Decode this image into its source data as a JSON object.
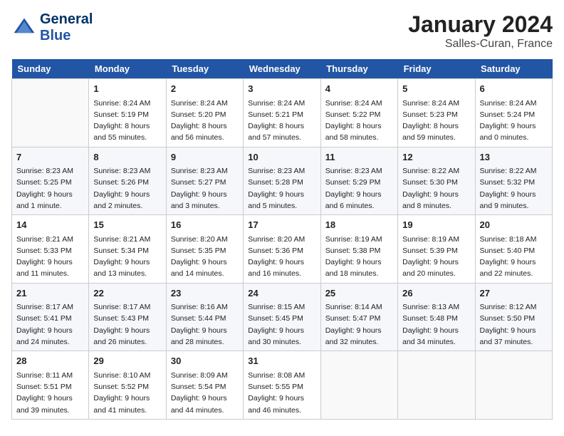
{
  "header": {
    "logo_general": "General",
    "logo_blue": "Blue",
    "month_title": "January 2024",
    "location": "Salles-Curan, France"
  },
  "days_of_week": [
    "Sunday",
    "Monday",
    "Tuesday",
    "Wednesday",
    "Thursday",
    "Friday",
    "Saturday"
  ],
  "weeks": [
    [
      {
        "day": "",
        "info": ""
      },
      {
        "day": "1",
        "info": "Sunrise: 8:24 AM\nSunset: 5:19 PM\nDaylight: 8 hours\nand 55 minutes."
      },
      {
        "day": "2",
        "info": "Sunrise: 8:24 AM\nSunset: 5:20 PM\nDaylight: 8 hours\nand 56 minutes."
      },
      {
        "day": "3",
        "info": "Sunrise: 8:24 AM\nSunset: 5:21 PM\nDaylight: 8 hours\nand 57 minutes."
      },
      {
        "day": "4",
        "info": "Sunrise: 8:24 AM\nSunset: 5:22 PM\nDaylight: 8 hours\nand 58 minutes."
      },
      {
        "day": "5",
        "info": "Sunrise: 8:24 AM\nSunset: 5:23 PM\nDaylight: 8 hours\nand 59 minutes."
      },
      {
        "day": "6",
        "info": "Sunrise: 8:24 AM\nSunset: 5:24 PM\nDaylight: 9 hours\nand 0 minutes."
      }
    ],
    [
      {
        "day": "7",
        "info": "Sunrise: 8:23 AM\nSunset: 5:25 PM\nDaylight: 9 hours\nand 1 minute."
      },
      {
        "day": "8",
        "info": "Sunrise: 8:23 AM\nSunset: 5:26 PM\nDaylight: 9 hours\nand 2 minutes."
      },
      {
        "day": "9",
        "info": "Sunrise: 8:23 AM\nSunset: 5:27 PM\nDaylight: 9 hours\nand 3 minutes."
      },
      {
        "day": "10",
        "info": "Sunrise: 8:23 AM\nSunset: 5:28 PM\nDaylight: 9 hours\nand 5 minutes."
      },
      {
        "day": "11",
        "info": "Sunrise: 8:23 AM\nSunset: 5:29 PM\nDaylight: 9 hours\nand 6 minutes."
      },
      {
        "day": "12",
        "info": "Sunrise: 8:22 AM\nSunset: 5:30 PM\nDaylight: 9 hours\nand 8 minutes."
      },
      {
        "day": "13",
        "info": "Sunrise: 8:22 AM\nSunset: 5:32 PM\nDaylight: 9 hours\nand 9 minutes."
      }
    ],
    [
      {
        "day": "14",
        "info": "Sunrise: 8:21 AM\nSunset: 5:33 PM\nDaylight: 9 hours\nand 11 minutes."
      },
      {
        "day": "15",
        "info": "Sunrise: 8:21 AM\nSunset: 5:34 PM\nDaylight: 9 hours\nand 13 minutes."
      },
      {
        "day": "16",
        "info": "Sunrise: 8:20 AM\nSunset: 5:35 PM\nDaylight: 9 hours\nand 14 minutes."
      },
      {
        "day": "17",
        "info": "Sunrise: 8:20 AM\nSunset: 5:36 PM\nDaylight: 9 hours\nand 16 minutes."
      },
      {
        "day": "18",
        "info": "Sunrise: 8:19 AM\nSunset: 5:38 PM\nDaylight: 9 hours\nand 18 minutes."
      },
      {
        "day": "19",
        "info": "Sunrise: 8:19 AM\nSunset: 5:39 PM\nDaylight: 9 hours\nand 20 minutes."
      },
      {
        "day": "20",
        "info": "Sunrise: 8:18 AM\nSunset: 5:40 PM\nDaylight: 9 hours\nand 22 minutes."
      }
    ],
    [
      {
        "day": "21",
        "info": "Sunrise: 8:17 AM\nSunset: 5:41 PM\nDaylight: 9 hours\nand 24 minutes."
      },
      {
        "day": "22",
        "info": "Sunrise: 8:17 AM\nSunset: 5:43 PM\nDaylight: 9 hours\nand 26 minutes."
      },
      {
        "day": "23",
        "info": "Sunrise: 8:16 AM\nSunset: 5:44 PM\nDaylight: 9 hours\nand 28 minutes."
      },
      {
        "day": "24",
        "info": "Sunrise: 8:15 AM\nSunset: 5:45 PM\nDaylight: 9 hours\nand 30 minutes."
      },
      {
        "day": "25",
        "info": "Sunrise: 8:14 AM\nSunset: 5:47 PM\nDaylight: 9 hours\nand 32 minutes."
      },
      {
        "day": "26",
        "info": "Sunrise: 8:13 AM\nSunset: 5:48 PM\nDaylight: 9 hours\nand 34 minutes."
      },
      {
        "day": "27",
        "info": "Sunrise: 8:12 AM\nSunset: 5:50 PM\nDaylight: 9 hours\nand 37 minutes."
      }
    ],
    [
      {
        "day": "28",
        "info": "Sunrise: 8:11 AM\nSunset: 5:51 PM\nDaylight: 9 hours\nand 39 minutes."
      },
      {
        "day": "29",
        "info": "Sunrise: 8:10 AM\nSunset: 5:52 PM\nDaylight: 9 hours\nand 41 minutes."
      },
      {
        "day": "30",
        "info": "Sunrise: 8:09 AM\nSunset: 5:54 PM\nDaylight: 9 hours\nand 44 minutes."
      },
      {
        "day": "31",
        "info": "Sunrise: 8:08 AM\nSunset: 5:55 PM\nDaylight: 9 hours\nand 46 minutes."
      },
      {
        "day": "",
        "info": ""
      },
      {
        "day": "",
        "info": ""
      },
      {
        "day": "",
        "info": ""
      }
    ]
  ]
}
